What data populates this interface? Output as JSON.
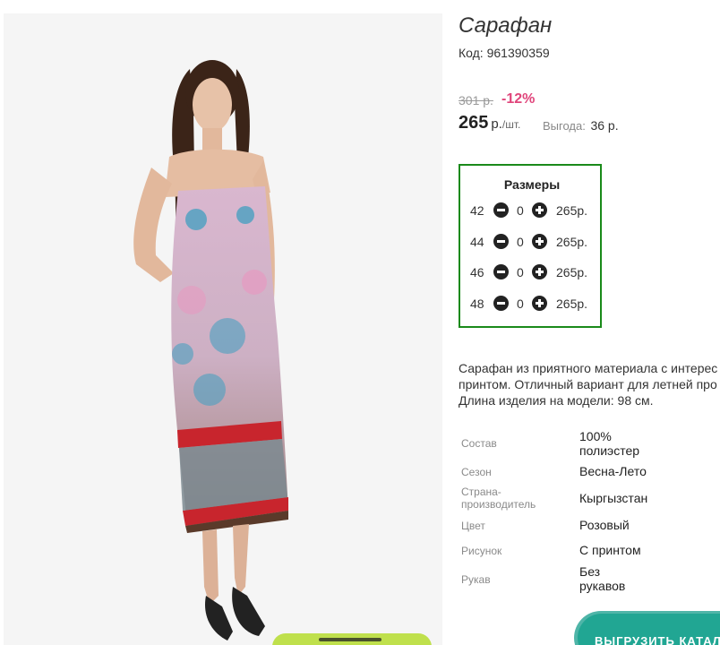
{
  "product": {
    "title": "Сарафан",
    "code_label": "Код:",
    "code": "961390359",
    "old_price": "301 р.",
    "discount": "-12%",
    "price": "265",
    "price_unit": "р.",
    "price_per": "/шт.",
    "savings_label": "Выгода:",
    "savings_value": "36 р."
  },
  "sizes": {
    "title": "Размеры",
    "rows": [
      {
        "size": "42",
        "qty": "0",
        "price": "265р."
      },
      {
        "size": "44",
        "qty": "0",
        "price": "265р."
      },
      {
        "size": "46",
        "qty": "0",
        "price": "265р."
      },
      {
        "size": "48",
        "qty": "0",
        "price": "265р."
      }
    ]
  },
  "description": {
    "lines": [
      "Сарафан из приятного материала с интерес",
      "принтом. Отличный вариант для летней про",
      "Длина изделия на модели: 98 см."
    ]
  },
  "attributes": [
    {
      "label": "Состав",
      "value_lines": [
        "100%",
        "полиэстер"
      ]
    },
    {
      "label": "Сезон",
      "value_lines": [
        "Весна-Лето"
      ]
    },
    {
      "label_lines": [
        "Страна-",
        "производитель"
      ],
      "value_lines": [
        "Кыргызстан"
      ]
    },
    {
      "label": "Цвет",
      "value_lines": [
        "Розовый"
      ]
    },
    {
      "label": "Рисунок",
      "value_lines": [
        "С принтом"
      ]
    },
    {
      "label": "Рукав",
      "value_lines": [
        "Без",
        "рукавов"
      ]
    }
  ],
  "catalog_button": {
    "label": "ВЫГРУЗИТЬ КАТАЛО"
  },
  "colors": {
    "accent_red": "#e0457b",
    "sizes_border": "#1a8a1a",
    "catalog_button": "#21a693",
    "green_button": "#bfe04c"
  },
  "icons": {
    "minus": "minus-circle-icon",
    "plus": "plus-circle-icon"
  }
}
